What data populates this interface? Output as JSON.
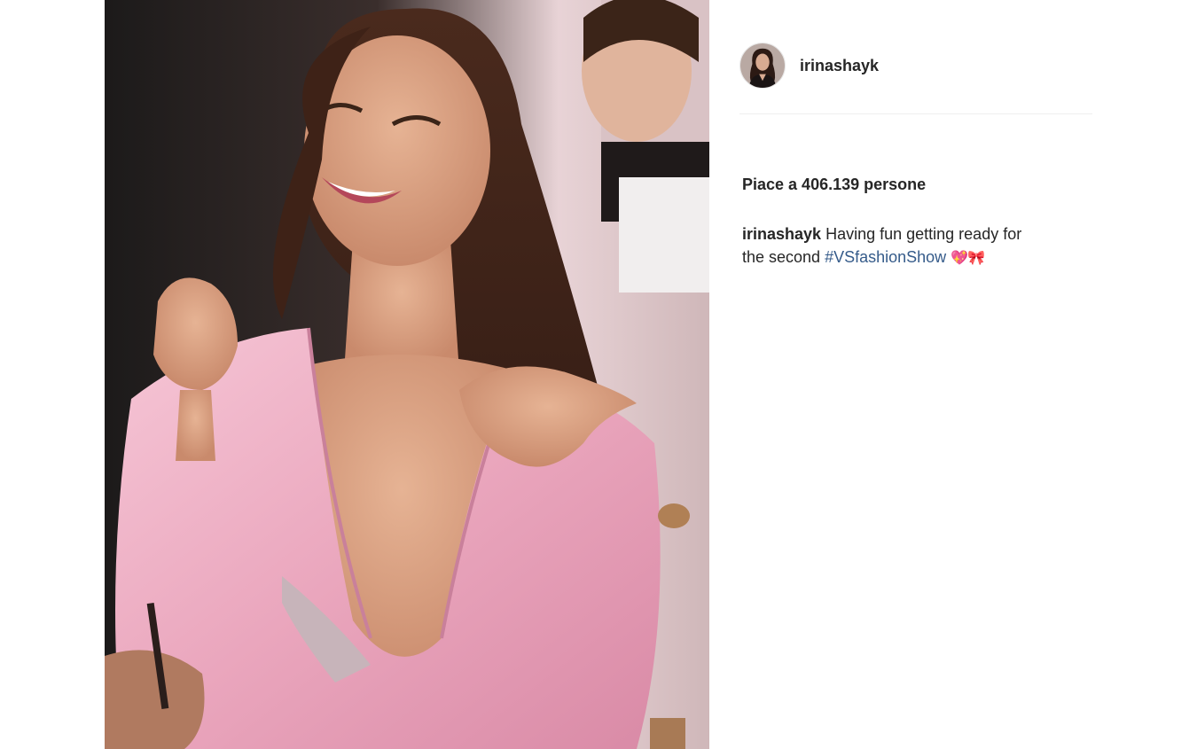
{
  "post": {
    "author": {
      "username": "irinashayk",
      "avatar_icon": "profile-avatar"
    },
    "likes_text": "Piace a 406.139 persone",
    "caption": {
      "username": "irinashayk",
      "text_line1": "Having fun getting ready for",
      "text_line2": "the second",
      "hashtag": "#VSfashionShow",
      "emoji": "💖🎀"
    }
  },
  "colors": {
    "hashtag": "#355b8a",
    "text": "#262626",
    "divider": "#efefef"
  }
}
